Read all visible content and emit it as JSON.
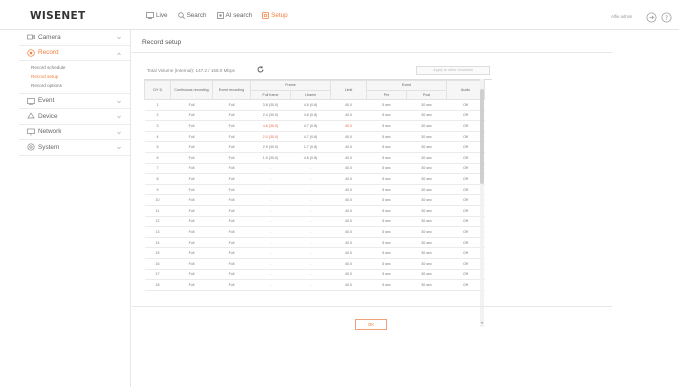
{
  "app": {
    "logo": "WISENET",
    "user": "Alfie admin"
  },
  "nav": [
    {
      "label": "Live",
      "icon": "live-icon",
      "active": false
    },
    {
      "label": "Search",
      "icon": "search-icon",
      "active": false
    },
    {
      "label": "AI search",
      "icon": "ai-search-icon",
      "active": false
    },
    {
      "label": "Setup",
      "icon": "setup-icon",
      "active": true
    }
  ],
  "topbar_icons": [
    "logout-icon",
    "help-icon"
  ],
  "sidebar": {
    "menus": [
      {
        "label": "Camera",
        "icon": "camera-icon",
        "active": false
      },
      {
        "label": "Record",
        "icon": "record-icon",
        "active": true,
        "sub": [
          {
            "label": "Record schedule",
            "active": false
          },
          {
            "label": "Record setup",
            "active": true
          },
          {
            "label": "Record options",
            "active": false
          }
        ]
      },
      {
        "label": "Event",
        "icon": "event-icon",
        "active": false
      },
      {
        "label": "Device",
        "icon": "device-icon",
        "active": false
      },
      {
        "label": "Network",
        "icon": "network-icon",
        "active": false
      },
      {
        "label": "System",
        "icon": "system-icon",
        "active": false
      }
    ]
  },
  "main": {
    "title": "Record setup",
    "total": "Total Volume (Internal): 147.2 / 158.0 Mbps",
    "apply_button": "Apply to other channels",
    "ok_button": "OK"
  },
  "accent_color": "#f07d3c",
  "table": {
    "headers": {
      "ch": "CH",
      "continuous": "Continuous recording",
      "event_rec": "Event recording",
      "frame": "Frame",
      "full_frame": "Full frame",
      "iframe": "I-frame",
      "limit": "Limit",
      "event": "Event",
      "pre": "Pre",
      "post": "Post",
      "audio": "Audio"
    },
    "rows": [
      {
        "ch": "1",
        "cont": "Full",
        "evt": "Full",
        "full": "3.8 (30.0)",
        "iframe": "4.6 (0.8)",
        "limit": "40.0",
        "pre": "5 sec",
        "post": "30 sec",
        "audio": "Off",
        "red_full": false,
        "red_limit": false
      },
      {
        "ch": "2",
        "cont": "Full",
        "evt": "Full",
        "full": "2.4 (30.0)",
        "iframe": "4.6 (0.8)",
        "limit": "40.0",
        "pre": "5 sec",
        "post": "30 sec",
        "audio": "Off",
        "red_full": false,
        "red_limit": false
      },
      {
        "ch": "3",
        "cont": "Full",
        "evt": "Full",
        "full": "4.6 (30.0)",
        "iframe": "4.7 (0.8)",
        "limit": "40.0",
        "pre": "5 sec",
        "post": "30 sec",
        "audio": "Off",
        "red_full": true,
        "red_limit": true
      },
      {
        "ch": "4",
        "cont": "Full",
        "evt": "Full",
        "full": "2.0 (30.0)",
        "iframe": "4.7 (0.8)",
        "limit": "40.0",
        "pre": "5 sec",
        "post": "30 sec",
        "audio": "Off",
        "red_full": true,
        "red_limit": false
      },
      {
        "ch": "5",
        "cont": "Full",
        "evt": "Full",
        "full": "2.9 (30.0)",
        "iframe": "1.7 (0.8)",
        "limit": "40.0",
        "pre": "5 sec",
        "post": "30 sec",
        "audio": "Off",
        "red_full": false,
        "red_limit": false
      },
      {
        "ch": "6",
        "cont": "Full",
        "evt": "Full",
        "full": "1.9 (30.0)",
        "iframe": "4.6 (0.8)",
        "limit": "40.0",
        "pre": "5 sec",
        "post": "30 sec",
        "audio": "Off",
        "red_full": false,
        "red_limit": false
      },
      {
        "ch": "7",
        "cont": "Full",
        "evt": "Full",
        "full": "-",
        "iframe": "-",
        "limit": "40.0",
        "pre": "5 sec",
        "post": "30 sec",
        "audio": "Off",
        "red_full": false,
        "red_limit": false
      },
      {
        "ch": "8",
        "cont": "Full",
        "evt": "Full",
        "full": "-",
        "iframe": "-",
        "limit": "40.0",
        "pre": "5 sec",
        "post": "30 sec",
        "audio": "Off",
        "red_full": false,
        "red_limit": false
      },
      {
        "ch": "9",
        "cont": "Full",
        "evt": "Full",
        "full": "-",
        "iframe": "-",
        "limit": "40.0",
        "pre": "5 sec",
        "post": "30 sec",
        "audio": "Off",
        "red_full": false,
        "red_limit": false
      },
      {
        "ch": "10",
        "cont": "Full",
        "evt": "Full",
        "full": "-",
        "iframe": "-",
        "limit": "40.0",
        "pre": "5 sec",
        "post": "30 sec",
        "audio": "Off",
        "red_full": false,
        "red_limit": false
      },
      {
        "ch": "11",
        "cont": "Full",
        "evt": "Full",
        "full": "-",
        "iframe": "-",
        "limit": "40.0",
        "pre": "5 sec",
        "post": "30 sec",
        "audio": "Off",
        "red_full": false,
        "red_limit": false
      },
      {
        "ch": "12",
        "cont": "Full",
        "evt": "Full",
        "full": "-",
        "iframe": "-",
        "limit": "40.0",
        "pre": "5 sec",
        "post": "30 sec",
        "audio": "Off",
        "red_full": false,
        "red_limit": false
      },
      {
        "ch": "13",
        "cont": "Full",
        "evt": "Full",
        "full": "-",
        "iframe": "-",
        "limit": "40.0",
        "pre": "5 sec",
        "post": "30 sec",
        "audio": "Off",
        "red_full": false,
        "red_limit": false
      },
      {
        "ch": "14",
        "cont": "Full",
        "evt": "Full",
        "full": "-",
        "iframe": "-",
        "limit": "40.0",
        "pre": "5 sec",
        "post": "30 sec",
        "audio": "Off",
        "red_full": false,
        "red_limit": false
      },
      {
        "ch": "15",
        "cont": "Full",
        "evt": "Full",
        "full": "-",
        "iframe": "-",
        "limit": "40.0",
        "pre": "5 sec",
        "post": "30 sec",
        "audio": "Off",
        "red_full": false,
        "red_limit": false
      },
      {
        "ch": "16",
        "cont": "Full",
        "evt": "Full",
        "full": "-",
        "iframe": "-",
        "limit": "40.0",
        "pre": "5 sec",
        "post": "30 sec",
        "audio": "Off",
        "red_full": false,
        "red_limit": false
      },
      {
        "ch": "17",
        "cont": "Full",
        "evt": "Full",
        "full": "-",
        "iframe": "-",
        "limit": "40.0",
        "pre": "5 sec",
        "post": "30 sec",
        "audio": "Off",
        "red_full": false,
        "red_limit": false
      },
      {
        "ch": "18",
        "cont": "Full",
        "evt": "Full",
        "full": "-",
        "iframe": "-",
        "limit": "40.0",
        "pre": "5 sec",
        "post": "30 sec",
        "audio": "Off",
        "red_full": false,
        "red_limit": false
      }
    ]
  }
}
